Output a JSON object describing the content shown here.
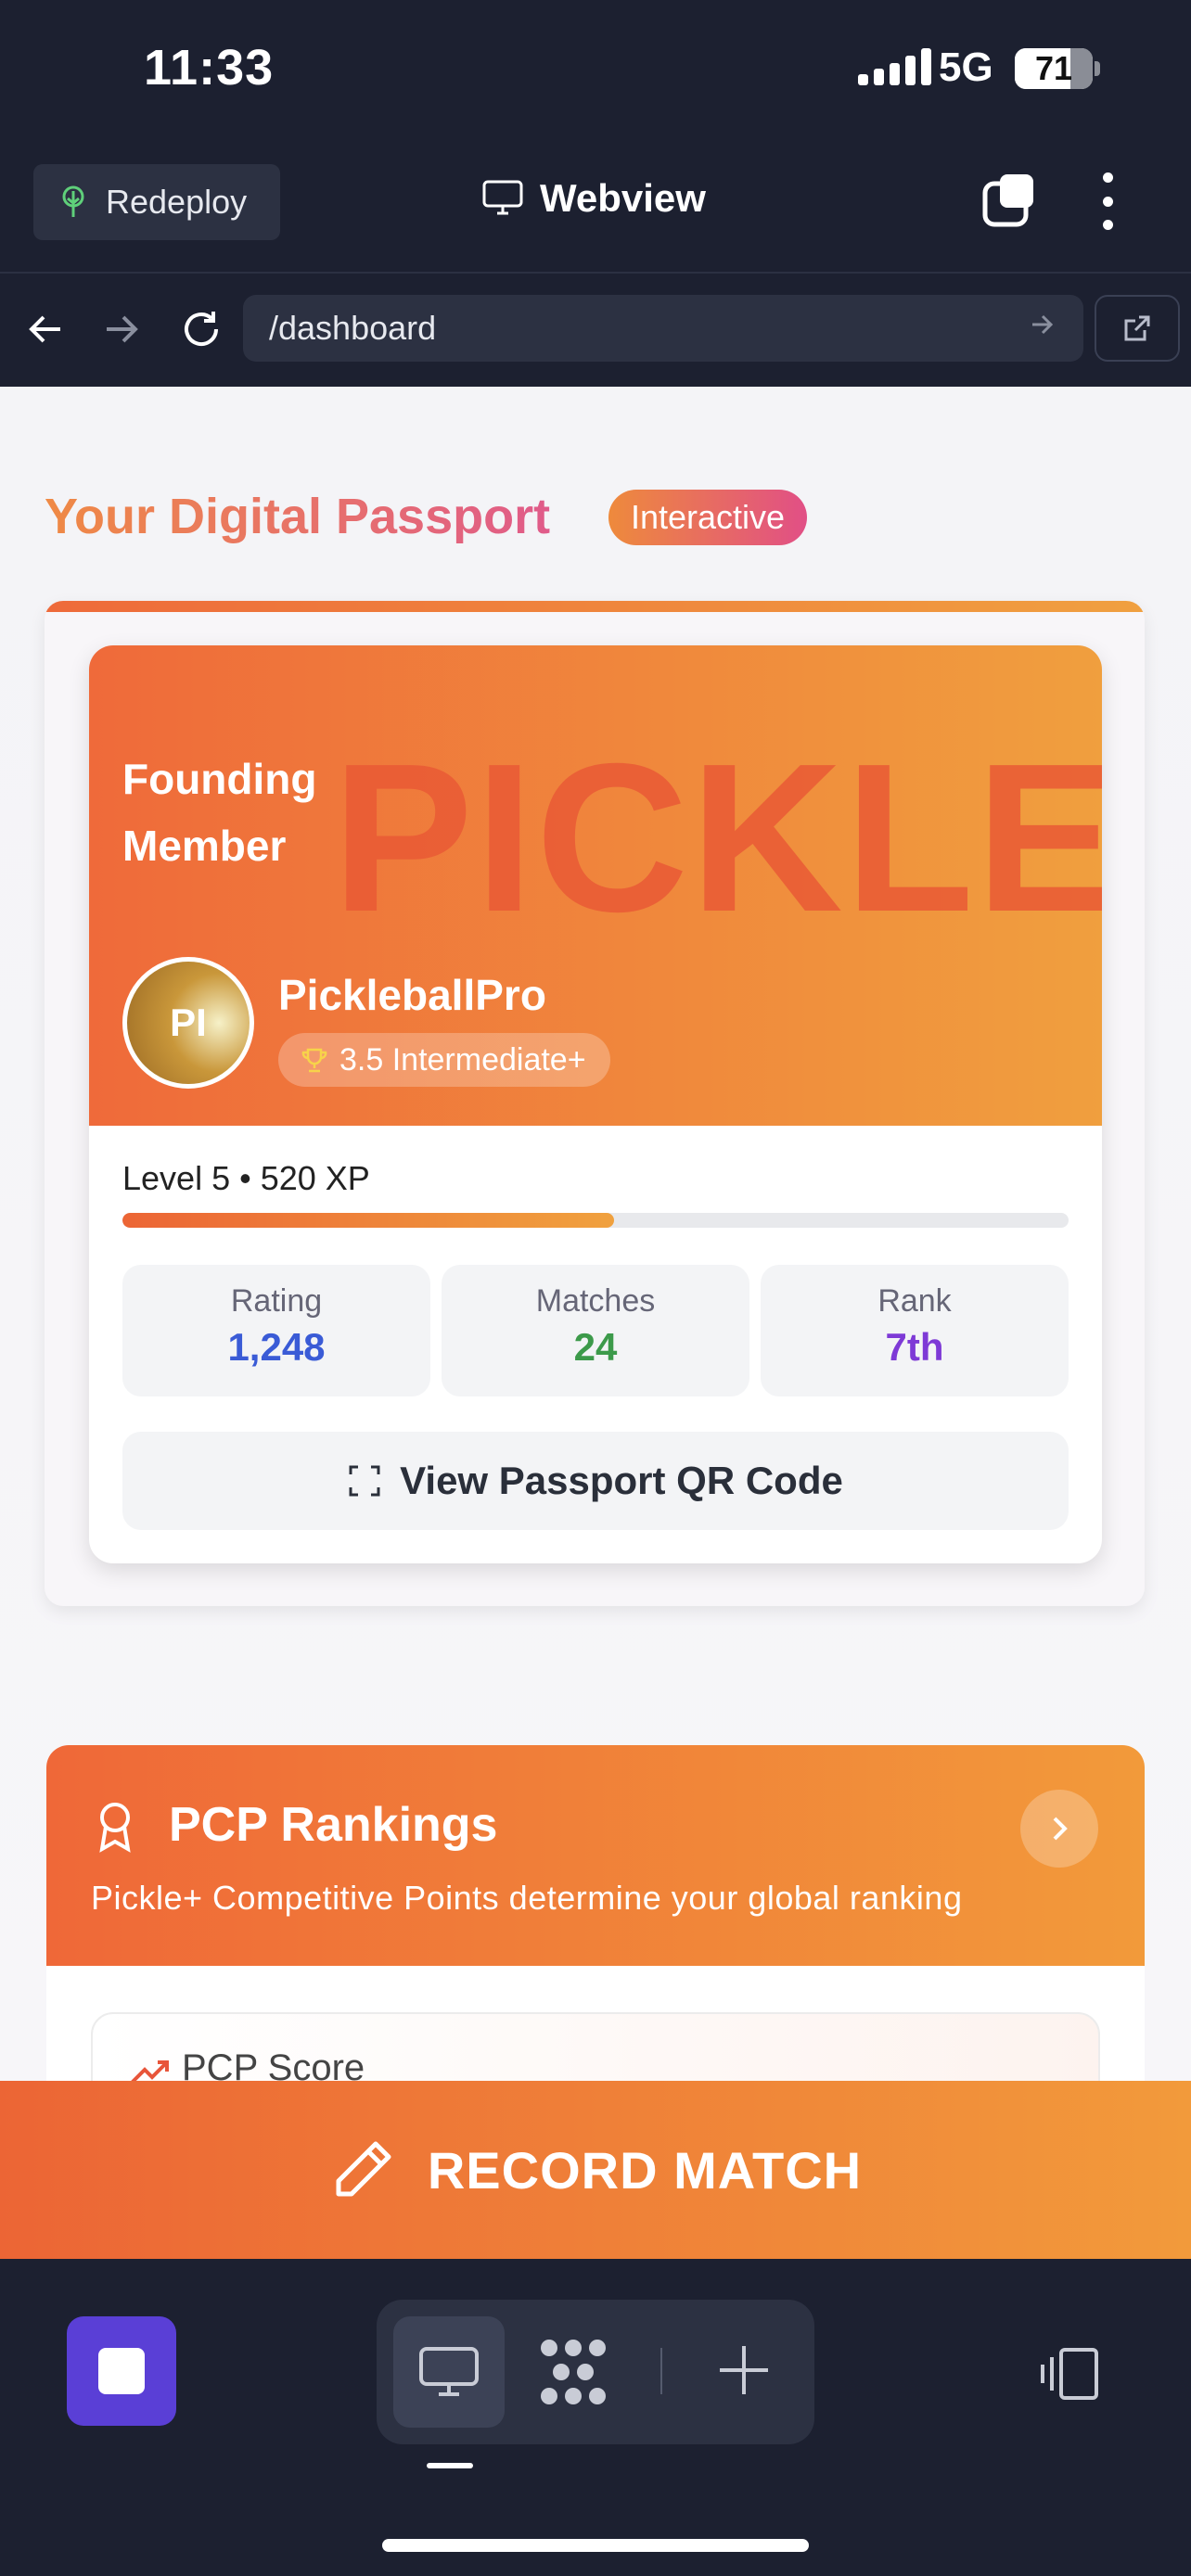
{
  "status_bar": {
    "time": "11:33",
    "network": "5G",
    "battery": "71"
  },
  "webview_header": {
    "redeploy_label": "Redeploy",
    "title": "Webview"
  },
  "browser": {
    "url": "/dashboard"
  },
  "passport_section": {
    "title": "Your Digital Passport",
    "badge": "Interactive"
  },
  "passport_card": {
    "member_label": "Founding Member",
    "background_word": "PICKLE",
    "avatar_initials": "PI",
    "username": "PickleballPro",
    "skill_level": "3.5 Intermediate+",
    "level_text": "Level 5 • 520 XP",
    "xp_progress_fraction": 0.52,
    "stats": [
      {
        "label": "Rating",
        "value": "1,248",
        "color": "#3a5bd6"
      },
      {
        "label": "Matches",
        "value": "24",
        "color": "#3c9a4a"
      },
      {
        "label": "Rank",
        "value": "7th",
        "color": "#7e3ad6"
      }
    ],
    "qr_button": "View Passport QR Code"
  },
  "pcp_rankings": {
    "title": "PCP Rankings",
    "subtitle": "Pickle+ Competitive Points determine your global ranking",
    "score_label": "PCP Score"
  },
  "record_match": {
    "label": "RECORD MATCH"
  },
  "colors": {
    "accent_orange": "#ef6a3a",
    "accent_pink": "#e05b8a",
    "dark_bg": "#1c2030",
    "stop_button": "#5a3fd6"
  }
}
